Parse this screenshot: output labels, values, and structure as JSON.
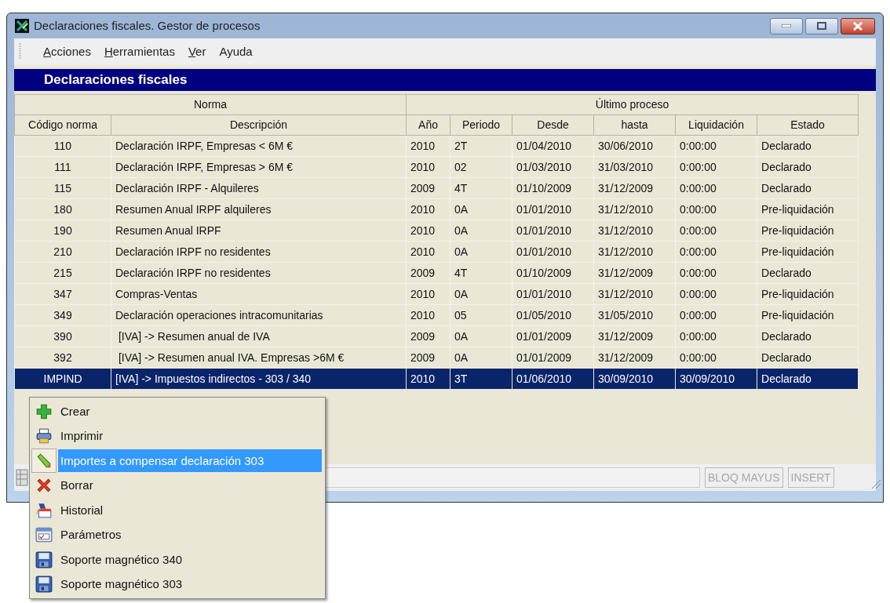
{
  "window": {
    "title": "Declaraciones fiscales. Gestor de procesos"
  },
  "menu_bar": [
    {
      "label": "Acciones",
      "mnemonic_underlined": true
    },
    {
      "label": "Herramientas",
      "mnemonic_underlined": true
    },
    {
      "label": "Ver",
      "mnemonic_underlined": true
    },
    {
      "label": "Ayuda",
      "mnemonic_underlined": false
    }
  ],
  "panel_title": "Declaraciones fiscales",
  "table": {
    "column_groups": [
      {
        "label": "Norma"
      },
      {
        "label": "Último proceso"
      }
    ],
    "columns": [
      "Código norma",
      "Descripción",
      "Año",
      "Periodo",
      "Desde",
      "hasta",
      "Liquidación",
      "Estado"
    ],
    "rows": [
      {
        "cells": [
          "110",
          "Declaración IRPF, Empresas < 6M €",
          "2010",
          "2T",
          "01/04/2010",
          "30/06/2010",
          "0:00:00",
          "Declarado"
        ],
        "selected": false
      },
      {
        "cells": [
          "111",
          "Declaración IRPF, Empresas > 6M €",
          "2010",
          "02",
          "01/03/2010",
          "31/03/2010",
          "0:00:00",
          "Declarado"
        ],
        "selected": false
      },
      {
        "cells": [
          "115",
          "Declaración IRPF - Alquileres",
          "2009",
          "4T",
          "01/10/2009",
          "31/12/2009",
          "0:00:00",
          "Declarado"
        ],
        "selected": false
      },
      {
        "cells": [
          "180",
          "Resumen Anual IRPF alquileres",
          "2010",
          "0A",
          "01/01/2010",
          "31/12/2010",
          "0:00:00",
          "Pre-liquidación"
        ],
        "selected": false
      },
      {
        "cells": [
          "190",
          "Resumen Anual IRPF",
          "2010",
          "0A",
          "01/01/2010",
          "31/12/2010",
          "0:00:00",
          "Pre-liquidación"
        ],
        "selected": false
      },
      {
        "cells": [
          "210",
          "Declaración IRPF no residentes",
          "2010",
          "0A",
          "01/01/2010",
          "31/12/2010",
          "0:00:00",
          "Pre-liquidación"
        ],
        "selected": false
      },
      {
        "cells": [
          "215",
          "Declaración IRPF no residentes",
          "2009",
          "4T",
          "01/10/2009",
          "31/12/2009",
          "0:00:00",
          "Declarado"
        ],
        "selected": false
      },
      {
        "cells": [
          "347",
          "Compras-Ventas",
          "2010",
          "0A",
          "01/01/2010",
          "31/12/2010",
          "0:00:00",
          "Pre-liquidación"
        ],
        "selected": false
      },
      {
        "cells": [
          "349",
          "Declaración operaciones intracomunitarias",
          "2010",
          "05",
          "01/05/2010",
          "31/05/2010",
          "0:00:00",
          "Pre-liquidación"
        ],
        "selected": false
      },
      {
        "cells": [
          "390",
          " [IVA] -> Resumen anual de IVA",
          "2009",
          "0A",
          "01/01/2009",
          "31/12/2009",
          "0:00:00",
          "Declarado"
        ],
        "selected": false
      },
      {
        "cells": [
          "392",
          " [IVA] -> Resumen anual IVA. Empresas >6M €",
          "2009",
          "0A",
          "01/01/2009",
          "31/12/2009",
          "0:00:00",
          "Declarado"
        ],
        "selected": false
      },
      {
        "cells": [
          "IMPIND",
          "[IVA] -> Impuestos indirectos - 303 / 340",
          "2010",
          "3T",
          "01/06/2010",
          "30/09/2010",
          "30/09/2010",
          "Declarado"
        ],
        "selected": true
      }
    ]
  },
  "status_bar": [
    "BLOQ MAYUS",
    "INSERT"
  ],
  "context_menu": [
    {
      "kind": "create",
      "label": "Crear",
      "selected": false
    },
    {
      "kind": "print",
      "label": "Imprimir",
      "selected": false
    },
    {
      "kind": "edit",
      "label": "Importes a compensar declaración 303",
      "selected": true
    },
    {
      "kind": "delete",
      "label": "Borrar",
      "selected": false
    },
    {
      "kind": "history",
      "label": "Historial",
      "selected": false
    },
    {
      "kind": "params",
      "label": "Parámetros",
      "selected": false
    },
    {
      "kind": "save",
      "label": "Soporte magnético 340",
      "selected": false
    },
    {
      "kind": "save",
      "label": "Soporte magnético 303",
      "selected": false
    }
  ]
}
